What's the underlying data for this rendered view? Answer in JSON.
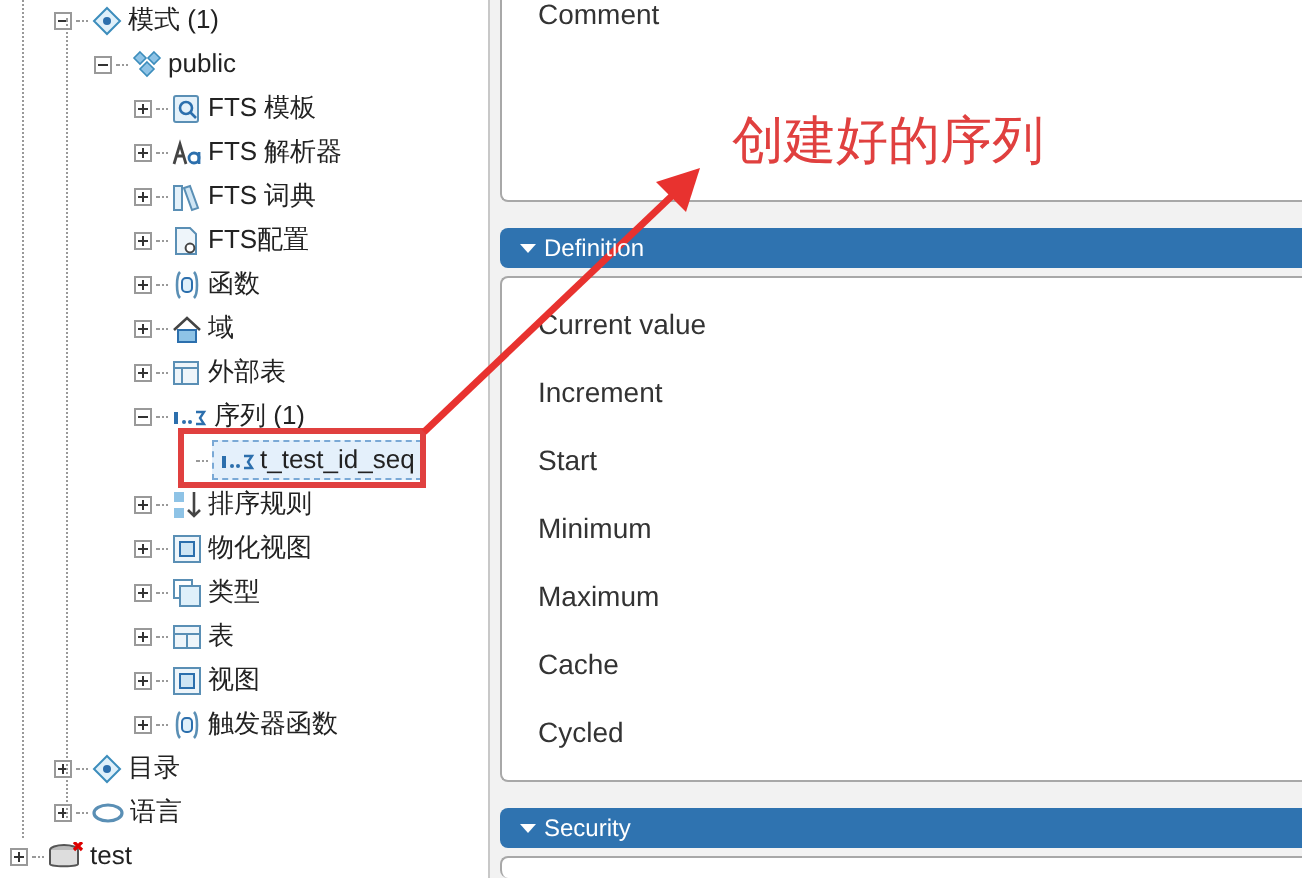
{
  "tree": {
    "nodes": [
      {
        "label": "模式 (1)",
        "kind": "schema",
        "expanded": true,
        "selected": false,
        "children": [
          {
            "label": "public",
            "kind": "public-schema",
            "expanded": true,
            "selected": false,
            "children": [
              {
                "label": "FTS 模板",
                "kind": "fts-template",
                "expanded": false,
                "selected": false
              },
              {
                "label": "FTS 解析器",
                "kind": "fts-parser",
                "expanded": false,
                "selected": false
              },
              {
                "label": "FTS 词典",
                "kind": "fts-dictionary",
                "expanded": false,
                "selected": false
              },
              {
                "label": "FTS配置",
                "kind": "fts-config",
                "expanded": false,
                "selected": false
              },
              {
                "label": "函数",
                "kind": "function",
                "expanded": false,
                "selected": false
              },
              {
                "label": "域",
                "kind": "domain",
                "expanded": false,
                "selected": false
              },
              {
                "label": "外部表",
                "kind": "foreign-table",
                "expanded": false,
                "selected": false
              },
              {
                "label": "序列 (1)",
                "kind": "sequence",
                "expanded": true,
                "selected": false,
                "children": [
                  {
                    "label": "t_test_id_seq",
                    "kind": "sequence",
                    "selected": true
                  }
                ]
              },
              {
                "label": "排序规则",
                "kind": "collation",
                "expanded": false,
                "selected": false
              },
              {
                "label": "物化视图",
                "kind": "view",
                "expanded": false,
                "selected": false
              },
              {
                "label": "类型",
                "kind": "type",
                "expanded": false,
                "selected": false
              },
              {
                "label": "表",
                "kind": "table",
                "expanded": false,
                "selected": false
              },
              {
                "label": "视图",
                "kind": "view",
                "expanded": false,
                "selected": false
              },
              {
                "label": "触发器函数",
                "kind": "function",
                "expanded": false,
                "selected": false
              }
            ]
          }
        ]
      },
      {
        "label": "目录",
        "kind": "schema",
        "expanded": false,
        "selected": false
      },
      {
        "label": "语言",
        "kind": "language",
        "expanded": false,
        "selected": false
      }
    ],
    "outer_nodes": [
      {
        "label": "test",
        "kind": "database",
        "expanded": false,
        "selected": false
      }
    ]
  },
  "comment_panel": {
    "label": "Comment"
  },
  "sections": [
    {
      "title": "Definition",
      "expanded": true,
      "fields": [
        "Current value",
        "Increment",
        "Start",
        "Minimum",
        "Maximum",
        "Cache",
        "Cycled"
      ]
    },
    {
      "title": "Security",
      "expanded": true
    }
  ],
  "annotation": {
    "text": "创建好的序列"
  }
}
